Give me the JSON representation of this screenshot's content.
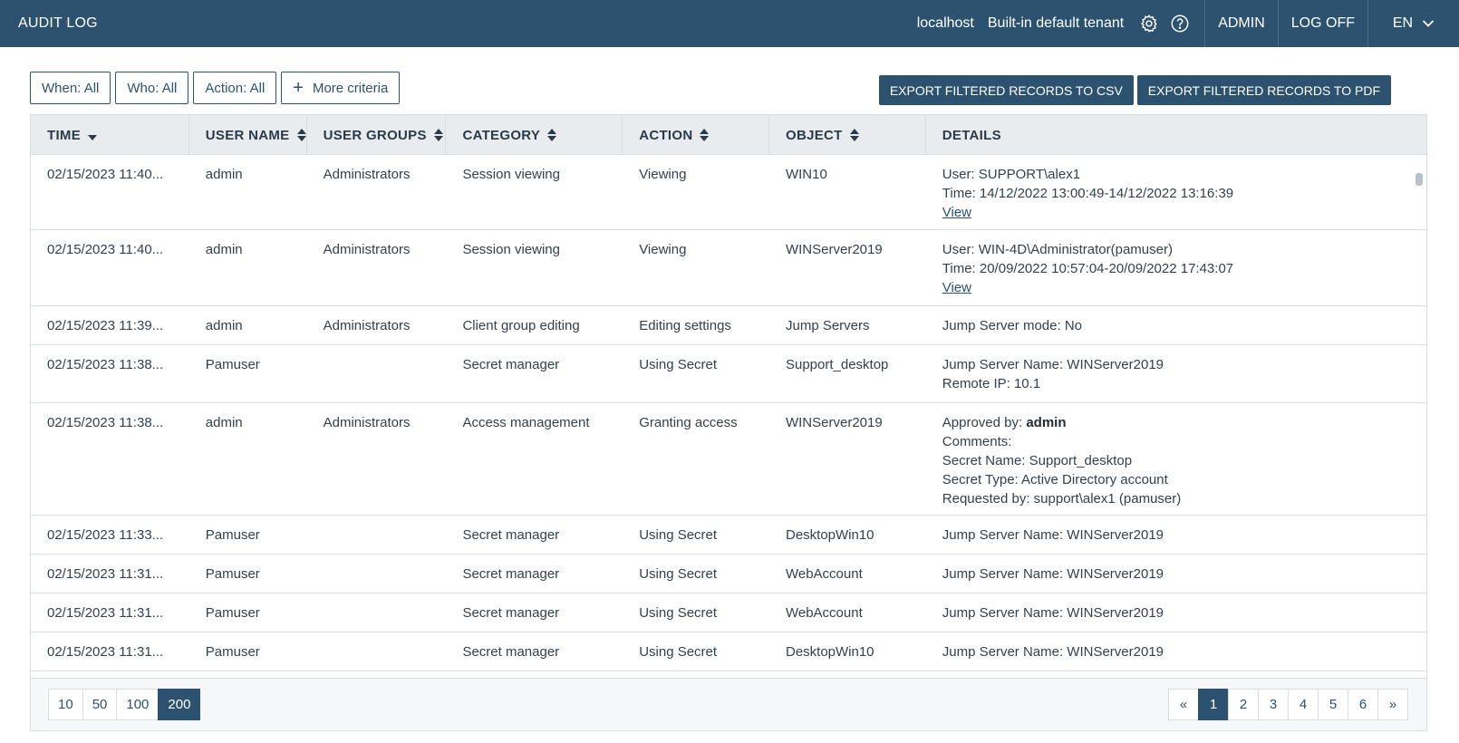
{
  "header": {
    "title": "AUDIT LOG",
    "host": "localhost",
    "tenant": "Built-in default tenant",
    "user_button": "ADMIN",
    "logoff_button": "LOG OFF",
    "language": "EN"
  },
  "filters": {
    "when": "When: All",
    "who": "Who: All",
    "action": "Action: All",
    "more": "More criteria"
  },
  "exports": {
    "csv": "EXPORT FILTERED RECORDS TO CSV",
    "pdf": "EXPORT FILTERED RECORDS TO PDF"
  },
  "columns": [
    "TIME",
    "USER NAME",
    "USER GROUPS",
    "CATEGORY",
    "ACTION",
    "OBJECT",
    "DETAILS"
  ],
  "rows": [
    {
      "time": "02/15/2023 11:40...",
      "user": "admin",
      "groups": "Administrators",
      "category": "Session viewing",
      "action": "Viewing",
      "object": "WIN10",
      "details": [
        "User: SUPPORT\\alex1",
        "Time: 14/12/2022 13:00:49-14/12/2022 13:16:39"
      ],
      "link": "View"
    },
    {
      "time": "02/15/2023 11:40...",
      "user": "admin",
      "groups": "Administrators",
      "category": "Session viewing",
      "action": "Viewing",
      "object": "WINServer2019",
      "details": [
        "User: WIN-4D\\Administrator(pamuser)",
        "Time: 20/09/2022 10:57:04-20/09/2022 17:43:07"
      ],
      "link": "View"
    },
    {
      "time": "02/15/2023 11:39...",
      "user": "admin",
      "groups": "Administrators",
      "category": "Client group editing",
      "action": "Editing settings",
      "object": "Jump Servers",
      "details": [
        "Jump Server mode: No"
      ]
    },
    {
      "time": "02/15/2023 11:38...",
      "user": "Pamuser",
      "groups": "",
      "category": "Secret manager",
      "action": "Using Secret",
      "object": "Support_desktop",
      "details": [
        "Jump Server Name: WINServer2019",
        "Remote IP: 10.1"
      ]
    },
    {
      "time": "02/15/2023 11:38...",
      "user": "admin",
      "groups": "Administrators",
      "category": "Access management",
      "action": "Granting access",
      "object": "WINServer2019",
      "approved_label": "Approved by: ",
      "approved_by": "admin",
      "details": [
        "Comments:",
        "Secret Name: Support_desktop",
        "Secret Type: Active Directory account",
        "Requested by: support\\alex1 (pamuser)"
      ]
    },
    {
      "time": "02/15/2023 11:33...",
      "user": "Pamuser",
      "groups": "",
      "category": "Secret manager",
      "action": "Using Secret",
      "object": "DesktopWin10",
      "details": [
        "Jump Server Name: WINServer2019"
      ]
    },
    {
      "time": "02/15/2023 11:31...",
      "user": "Pamuser",
      "groups": "",
      "category": "Secret manager",
      "action": "Using Secret",
      "object": "WebAccount",
      "details": [
        "Jump Server Name: WINServer2019"
      ]
    },
    {
      "time": "02/15/2023 11:31...",
      "user": "Pamuser",
      "groups": "",
      "category": "Secret manager",
      "action": "Using Secret",
      "object": "WebAccount",
      "details": [
        "Jump Server Name: WINServer2019"
      ]
    },
    {
      "time": "02/15/2023 11:31...",
      "user": "Pamuser",
      "groups": "",
      "category": "Secret manager",
      "action": "Using Secret",
      "object": "DesktopWin10",
      "details": [
        "Jump Server Name: WINServer2019"
      ]
    }
  ],
  "page_sizes": [
    "10",
    "50",
    "100",
    "200"
  ],
  "active_page_size": "200",
  "pagination": {
    "prev": "«",
    "pages": [
      "1",
      "2",
      "3",
      "4",
      "5",
      "6"
    ],
    "active": "1",
    "next": "»"
  },
  "colors": {
    "brand": "#2c5270",
    "header_bg": "#e9ecef"
  }
}
